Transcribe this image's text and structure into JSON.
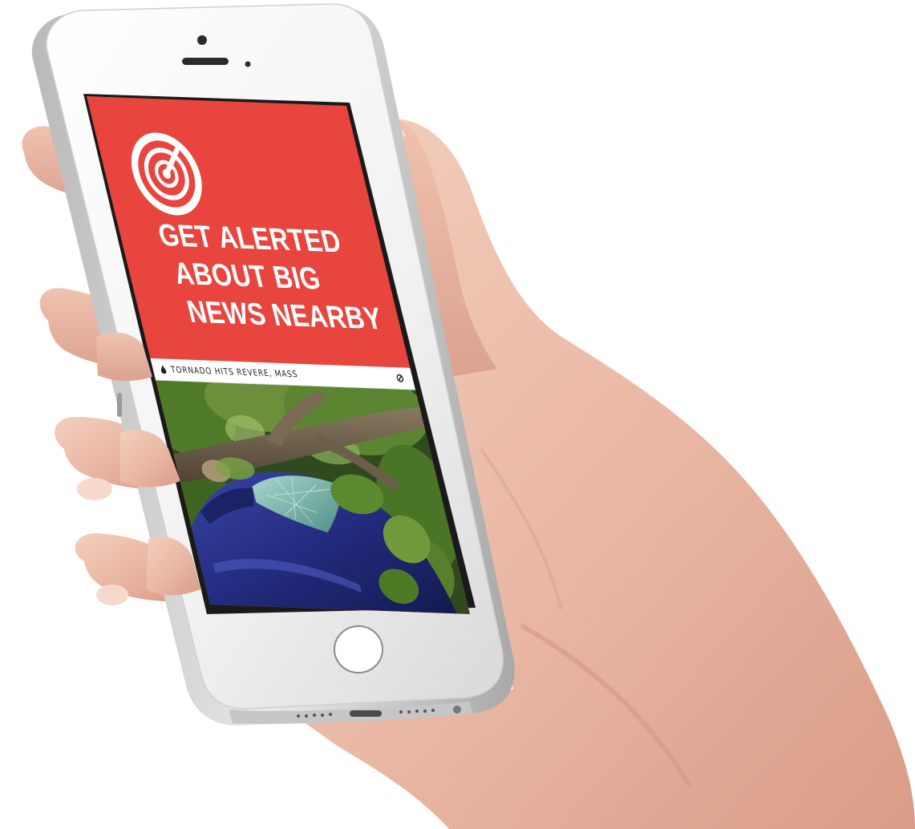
{
  "banner": {
    "headline_line1": "GET ALERTED",
    "headline_line2": "ABOUT BIG",
    "headline_line3": "NEWS NEARBY",
    "background_color": "#e8453e"
  },
  "ticker": {
    "text": "TORNADO HITS REVERE, MASS",
    "left_icon": "drop-icon",
    "right_icon": "no-symbol-icon"
  },
  "icons": {
    "app_logo": "radar-icon"
  },
  "photo": {
    "subject_icon": "fallen-tree-on-car-photo"
  }
}
